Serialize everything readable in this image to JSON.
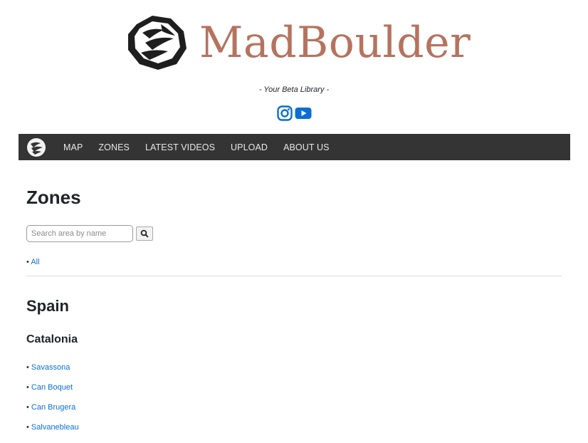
{
  "header": {
    "brand_name": "MadBoulder",
    "tagline": "- Your Beta Library -",
    "brand_color": "#b5735f",
    "social": [
      {
        "name": "instagram-icon",
        "color": "#0b6fd1"
      },
      {
        "name": "youtube-icon",
        "color": "#0b6fd1"
      }
    ]
  },
  "nav": {
    "background": "#343434",
    "items": [
      {
        "label": "MAP"
      },
      {
        "label": "ZONES"
      },
      {
        "label": "LATEST VIDEOS"
      },
      {
        "label": "UPLOAD"
      },
      {
        "label": "ABOUT US"
      }
    ]
  },
  "main": {
    "title": "Zones",
    "search": {
      "placeholder": "Search area by name",
      "value": ""
    },
    "all_link": "All",
    "bullet": "•",
    "country": "Spain",
    "region": "Catalonia",
    "zones": [
      "Savassona",
      "Can Boquet",
      "Can Brugera",
      "Salvanebleau"
    ],
    "link_color": "#0b6fd1"
  }
}
